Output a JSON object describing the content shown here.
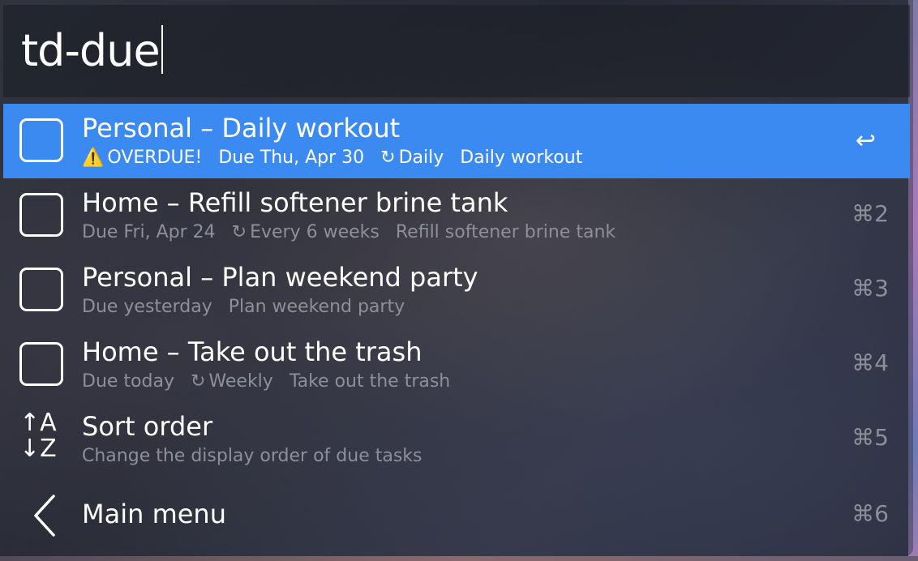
{
  "search": {
    "query": "td-due"
  },
  "results": [
    {
      "title": "Personal – Daily workout",
      "warning": "⚠️",
      "status": "OVERDUE!",
      "due": "Due Thu, Apr 30",
      "repeat_icon": "↻",
      "repeat": "Daily",
      "note": "Daily workout",
      "shortcut": "↩"
    },
    {
      "title": "Home – Refill softener brine tank",
      "due": "Due Fri, Apr 24",
      "repeat_icon": "↻",
      "repeat": "Every 6 weeks",
      "note": "Refill softener brine tank",
      "shortcut": "⌘2"
    },
    {
      "title": "Personal – Plan weekend party",
      "due": "Due yesterday",
      "note": "Plan weekend party",
      "shortcut": "⌘3"
    },
    {
      "title": "Home – Take out the trash",
      "due": "Due today",
      "repeat_icon": "↻",
      "repeat": "Weekly",
      "note": "Take out the trash",
      "shortcut": "⌘4"
    },
    {
      "title": "Sort order",
      "subtitle": "Change the display order of due tasks",
      "icon_top": "↑A",
      "icon_bottom": "↓Z",
      "shortcut": "⌘5"
    },
    {
      "title": "Main menu",
      "shortcut": "⌘6"
    }
  ],
  "colors": {
    "selection": "#3a8af2",
    "muted_text": "#8d8f99"
  }
}
